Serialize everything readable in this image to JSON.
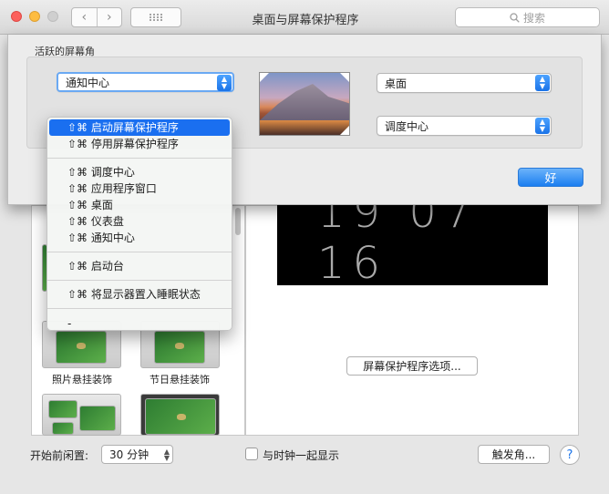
{
  "window": {
    "title": "桌面与屏幕保护程序",
    "search_placeholder": "搜索",
    "back": "‹",
    "forward": "›"
  },
  "hot_corners": {
    "group_label": "活跃的屏幕角",
    "top_left": "通知中心",
    "top_right": "桌面",
    "bottom_right": "调度中心",
    "ok_label": "好",
    "menu": {
      "groups": [
        [
          "⇧⌘ 启动屏幕保护程序",
          "⇧⌘ 停用屏幕保护程序"
        ],
        [
          "⇧⌘ 调度中心",
          "⇧⌘ 应用程序窗口",
          "⇧⌘ 桌面",
          "⇧⌘ 仪表盘",
          "⇧⌘ 通知中心"
        ],
        [
          "⇧⌘ 启动台"
        ],
        [
          "⇧⌘ 将显示器置入睡眠状态"
        ]
      ],
      "dash": "-",
      "highlighted": "⇧⌘ 启动屏幕保护程序"
    }
  },
  "screensaver": {
    "items": [
      {
        "label": "照片悬挂装饰"
      },
      {
        "label": "节日悬挂装饰"
      }
    ],
    "preview_clock": "19 07 16",
    "options_label": "屏幕保护程序选项..."
  },
  "footer": {
    "idle_label": "开始前闲置:",
    "idle_value": "30 分钟",
    "show_clock_label": "与时钟一起显示",
    "show_clock_checked": false,
    "hot_corners_button": "触发角...",
    "help": "?"
  },
  "colors": {
    "accent": "#1a73e8",
    "menu_highlight": "#1a6ff0"
  }
}
